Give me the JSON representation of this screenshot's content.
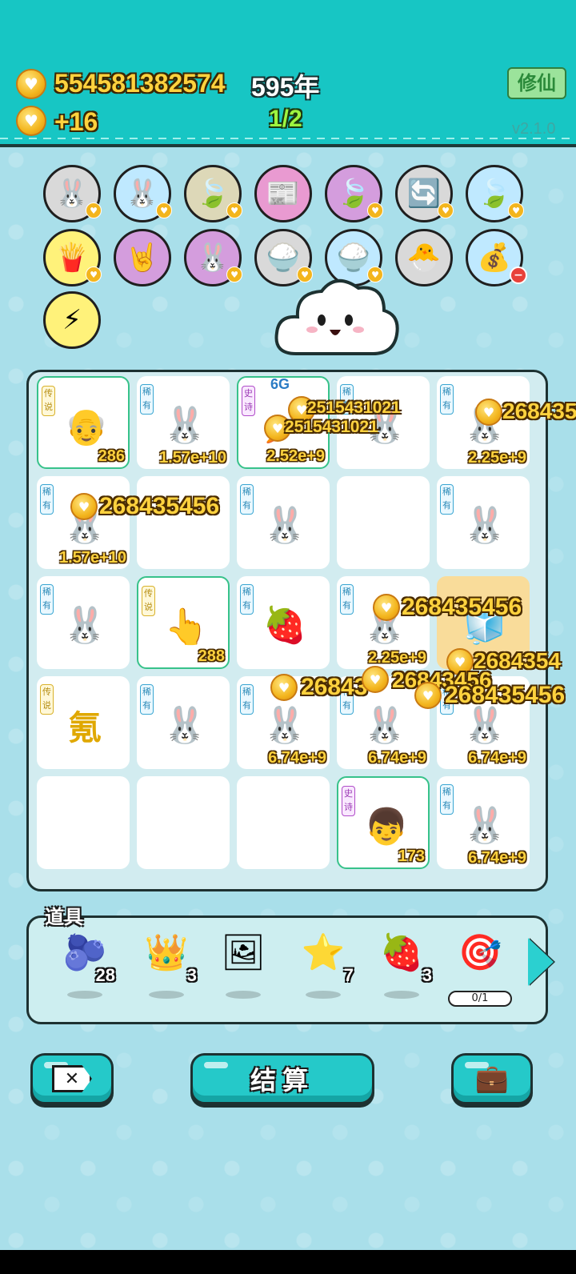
{
  "header": {
    "coins": "554581382574",
    "income": "+16",
    "year": "595年",
    "page": "1/2",
    "xiuxian_label": "修仙",
    "version": "v2.1.0"
  },
  "skills": [
    {
      "name": "rabbit",
      "glyph": "🐰",
      "bg": "#d9d9d9",
      "badge": "heart"
    },
    {
      "name": "rabbit",
      "glyph": "🐰",
      "bg": "#bfe9ff",
      "badge": "heart"
    },
    {
      "name": "leaf",
      "glyph": "🍃",
      "bg": "#ddd8b8",
      "badge": "heart"
    },
    {
      "name": "time-magazine",
      "glyph": "📰",
      "bg": "#e99ad1",
      "badge": "none"
    },
    {
      "name": "leaf",
      "glyph": "🍃",
      "bg": "#d49ddd",
      "badge": "heart"
    },
    {
      "name": "refresh",
      "glyph": "🔄",
      "bg": "#d9d9d9",
      "badge": "heart"
    },
    {
      "name": "leaf",
      "glyph": "🍃",
      "bg": "#bfe9ff",
      "badge": "heart"
    },
    {
      "name": "fries",
      "glyph": "🍟",
      "bg": "#fff27a",
      "badge": "heart"
    },
    {
      "name": "rock-hand",
      "glyph": "🤘",
      "bg": "#d49ddd",
      "badge": "none"
    },
    {
      "name": "rabbit",
      "glyph": "🐰",
      "bg": "#d49ddd",
      "badge": "heart"
    },
    {
      "name": "rice-bowl",
      "glyph": "🍚",
      "bg": "#d9d9d9",
      "badge": "heart"
    },
    {
      "name": "rice-bowl",
      "glyph": "🍚",
      "bg": "#bfe9ff",
      "badge": "heart"
    },
    {
      "name": "chick",
      "glyph": "🐣",
      "bg": "#d9d9d9",
      "badge": "none"
    },
    {
      "name": "sack",
      "glyph": "💰",
      "bg": "#bfe9ff",
      "badge": "minus"
    },
    {
      "name": "lightning",
      "glyph": "⚡",
      "bg": "#fff27a",
      "badge": "none"
    }
  ],
  "badges": {
    "legend": "传说",
    "rare": "稀有",
    "epic": "史诗"
  },
  "board": [
    {
      "sprite": "👴",
      "badge": "legend",
      "value": "286",
      "style": "green"
    },
    {
      "sprite": "🐰",
      "badge": "rare",
      "value": "1.57e+10",
      "style": "plain"
    },
    {
      "sprite": "🥕",
      "badge": "epic",
      "value": "2.52e+9",
      "style": "green",
      "top_label": "6G"
    },
    {
      "sprite": "🐰",
      "badge": "rare",
      "value": "",
      "style": "plain"
    },
    {
      "sprite": "🐰",
      "badge": "rare",
      "value": "2.25e+9",
      "style": "plain"
    },
    {
      "sprite": "🐰",
      "badge": "rare",
      "value": "1.57e+10",
      "style": "plain"
    },
    {
      "sprite": "",
      "badge": "",
      "value": "",
      "style": "plain"
    },
    {
      "sprite": "🐰",
      "badge": "rare",
      "value": "",
      "style": "plain"
    },
    {
      "sprite": "",
      "badge": "",
      "value": "",
      "style": "plain"
    },
    {
      "sprite": "🐰",
      "badge": "rare",
      "value": "",
      "style": "plain"
    },
    {
      "sprite": "🐰",
      "badge": "rare",
      "value": "",
      "style": "plain"
    },
    {
      "sprite": "👆",
      "badge": "legend",
      "value": "288",
      "style": "green"
    },
    {
      "sprite": "🍓",
      "badge": "rare",
      "value": "",
      "style": "plain"
    },
    {
      "sprite": "🐰",
      "badge": "rare",
      "value": "2.25e+9",
      "style": "plain"
    },
    {
      "sprite": "🧊",
      "badge": "",
      "value": "",
      "style": "orange"
    },
    {
      "sprite": "氪",
      "badge": "legend",
      "value": "",
      "style": "plain"
    },
    {
      "sprite": "🐰",
      "badge": "rare",
      "value": "",
      "style": "plain"
    },
    {
      "sprite": "🐰",
      "badge": "rare",
      "value": "6.74e+9",
      "style": "plain"
    },
    {
      "sprite": "🐰",
      "badge": "rare",
      "value": "6.74e+9",
      "style": "plain"
    },
    {
      "sprite": "🐰",
      "badge": "rare",
      "value": "6.74e+9",
      "style": "plain"
    },
    {
      "sprite": "",
      "badge": "",
      "value": "",
      "style": "plain"
    },
    {
      "sprite": "",
      "badge": "",
      "value": "",
      "style": "plain"
    },
    {
      "sprite": "",
      "badge": "",
      "value": "",
      "style": "plain"
    },
    {
      "sprite": "👦",
      "badge": "epic",
      "value": "173",
      "style": "green"
    },
    {
      "sprite": "🐰",
      "badge": "rare",
      "value": "6.74e+9",
      "style": "plain"
    }
  ],
  "floating_numbers": {
    "f1": "2515431021",
    "f2": "2515431021",
    "f3": "268435",
    "f4": "268435456",
    "f5": "268435456",
    "f6": "2684354",
    "f7": "26843",
    "f8": "26843456",
    "f9": "268435456"
  },
  "items": {
    "label": "道具",
    "list": [
      {
        "name": "blueberry",
        "glyph": "🫐",
        "count": "28"
      },
      {
        "name": "crown",
        "glyph": "👑",
        "count": "3"
      },
      {
        "name": "picture-frame",
        "glyph": "🖼",
        "count": ""
      },
      {
        "name": "star",
        "glyph": "⭐",
        "count": "7"
      },
      {
        "name": "strawberry",
        "glyph": "🍓",
        "count": "3"
      },
      {
        "name": "target-8",
        "glyph": "🎯",
        "count": "",
        "progress": "0/1"
      }
    ]
  },
  "buttons": {
    "close_icon": "✕",
    "settle_label": "结算",
    "briefcase_icon": "💼"
  }
}
